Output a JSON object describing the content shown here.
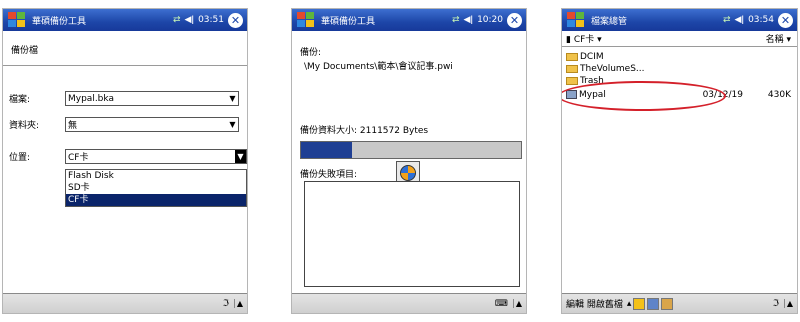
{
  "screen1": {
    "title": "華碩備份工具",
    "time": "03:51",
    "heading": "備份檔",
    "fields": [
      {
        "label": "檔案:",
        "value": "Mypal.bka"
      },
      {
        "label": "資料夾:",
        "value": "無"
      },
      {
        "label": "位置:",
        "value": "CF卡"
      }
    ],
    "options": [
      "Flash Disk",
      "SD卡",
      "CF卡"
    ],
    "selected_option": "CF卡"
  },
  "screen2": {
    "title": "華碩備份工具",
    "time": "10:20",
    "backup_label": "備份:",
    "backup_path": "\\My Documents\\範本\\會议記事.pwi",
    "size_text": "備份資料大小: 2111572 Bytes",
    "progress_fraction": 0.23,
    "failed_label": "備份失敗項目:"
  },
  "screen3": {
    "title": "檔案總管",
    "time": "03:54",
    "location": "CF卡",
    "sort_label": "名稱",
    "files": [
      {
        "name": "DCIM",
        "kind": "folder",
        "date": "",
        "size": ""
      },
      {
        "name": "TheVolumeS...",
        "kind": "folder",
        "date": "",
        "size": ""
      },
      {
        "name": "Trash",
        "kind": "folder",
        "date": "",
        "size": ""
      },
      {
        "name": "Mypal",
        "kind": "file",
        "date": "03/12/19",
        "size": "430K"
      }
    ],
    "bottom_left": "編輯 開啟舊檔"
  },
  "colors": {
    "titlebar": "#1d46a8",
    "highlight": "#d4202a",
    "progress": "#1f3f93",
    "selection": "#0a246a"
  }
}
